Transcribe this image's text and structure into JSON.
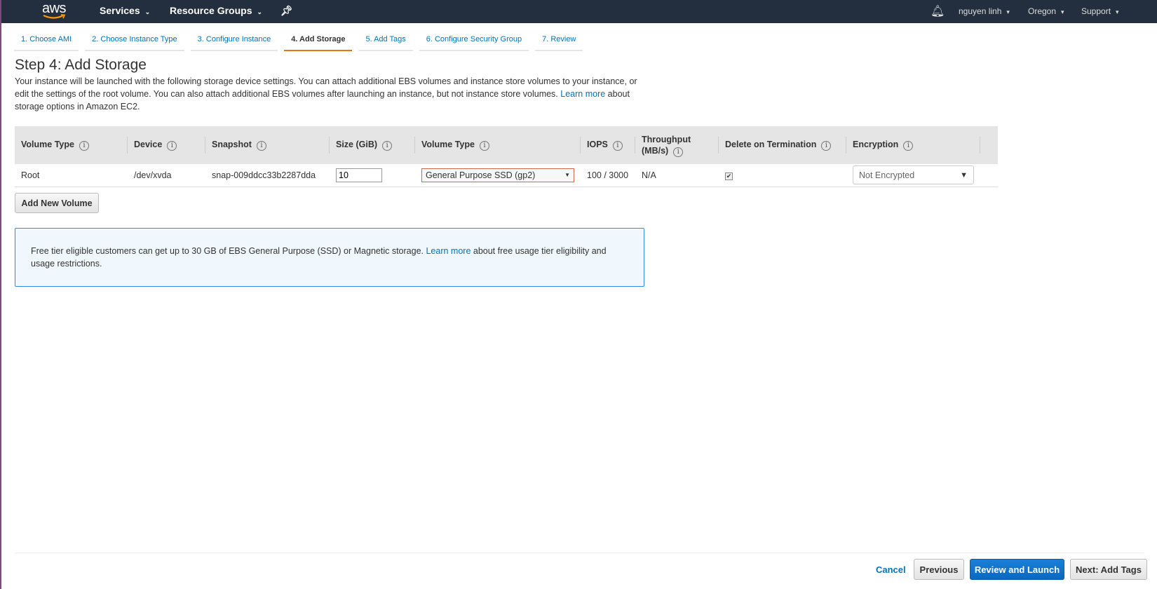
{
  "nav": {
    "logo": "aws",
    "services": "Services",
    "resource_groups": "Resource Groups",
    "user": "nguyen linh",
    "region": "Oregon",
    "support": "Support"
  },
  "steps": [
    "1. Choose AMI",
    "2. Choose Instance Type",
    "3. Configure Instance",
    "4. Add Storage",
    "5. Add Tags",
    "6. Configure Security Group",
    "7. Review"
  ],
  "page": {
    "title": "Step 4: Add Storage",
    "desc_1": "Your instance will be launched with the following storage device settings. You can attach additional EBS volumes and instance store volumes to your instance, or edit the settings of the root volume. You can also attach additional EBS volumes after launching an instance, but not instance store volumes. ",
    "learn_more": "Learn more",
    "desc_2": " about storage options in Amazon EC2."
  },
  "table": {
    "headers": [
      "Volume Type",
      "Device",
      "Snapshot",
      "Size (GiB)",
      "Volume Type",
      "IOPS",
      "Throughput (MB/s)",
      "Delete on Termination",
      "Encryption"
    ],
    "row": {
      "type": "Root",
      "device": "/dev/xvda",
      "snapshot": "snap-009ddcc33b2287dda",
      "size": "10",
      "volume_type": "General Purpose SSD (gp2)",
      "iops": "100 / 3000",
      "throughput": "N/A",
      "delete_on_termination": true,
      "encryption": "Not Encrypted"
    }
  },
  "add_volume": "Add New Volume",
  "notice": {
    "text_1": "Free tier eligible customers can get up to 30 GB of EBS General Purpose (SSD) or Magnetic storage. ",
    "learn_more": "Learn more",
    "text_2": " about free usage tier eligibility and usage restrictions."
  },
  "footer": {
    "cancel": "Cancel",
    "previous": "Previous",
    "review": "Review and Launch",
    "next": "Next: Add Tags"
  },
  "colors": {
    "nav": "#232f3e",
    "accent": "#ec7211",
    "primary": "#0972d3"
  }
}
